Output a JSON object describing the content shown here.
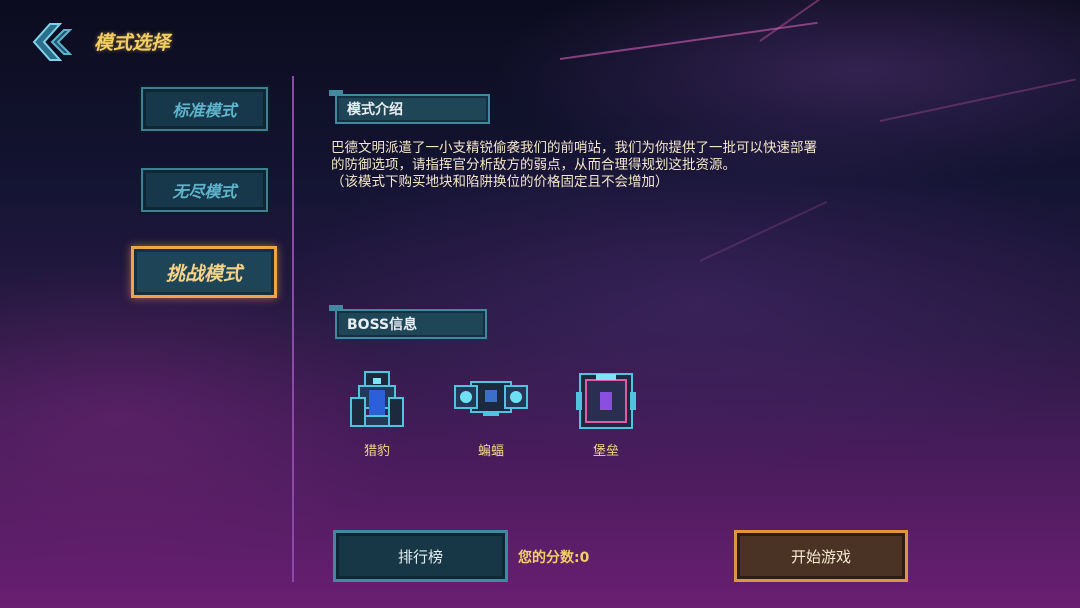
{
  "header": {
    "title": "模式选择",
    "back_icon": "back-arrow-icon"
  },
  "modes": [
    {
      "label": "标准模式",
      "active": false
    },
    {
      "label": "无尽模式",
      "active": false
    },
    {
      "label": "挑战模式",
      "active": true
    }
  ],
  "intro": {
    "heading": "模式介绍",
    "lines": [
      "巴德文明派遣了一小支精锐偷袭我们的前哨站，我们为你提供了一批可以快速部署",
      "的防御选项，请指挥官分析敌方的弱点，从而合理得规划这批资源。",
      "（该模式下购买地块和陷阱换位的价格固定且不会增加）"
    ]
  },
  "boss_section": {
    "heading": "BOSS信息",
    "bosses": [
      {
        "name": "猎豹",
        "icon": "cheetah-ship-icon"
      },
      {
        "name": "蝙蝠",
        "icon": "bat-ship-icon"
      },
      {
        "name": "堡垒",
        "icon": "fortress-ship-icon"
      }
    ]
  },
  "footer": {
    "rank_label": "排行榜",
    "score_label": "您的分数:0",
    "start_label": "开始游戏"
  },
  "colors": {
    "accent_gold": "#f3cf63",
    "accent_orange": "#e0943f",
    "panel_teal": "#3f8aa0",
    "divider": "#8b4aa8"
  }
}
